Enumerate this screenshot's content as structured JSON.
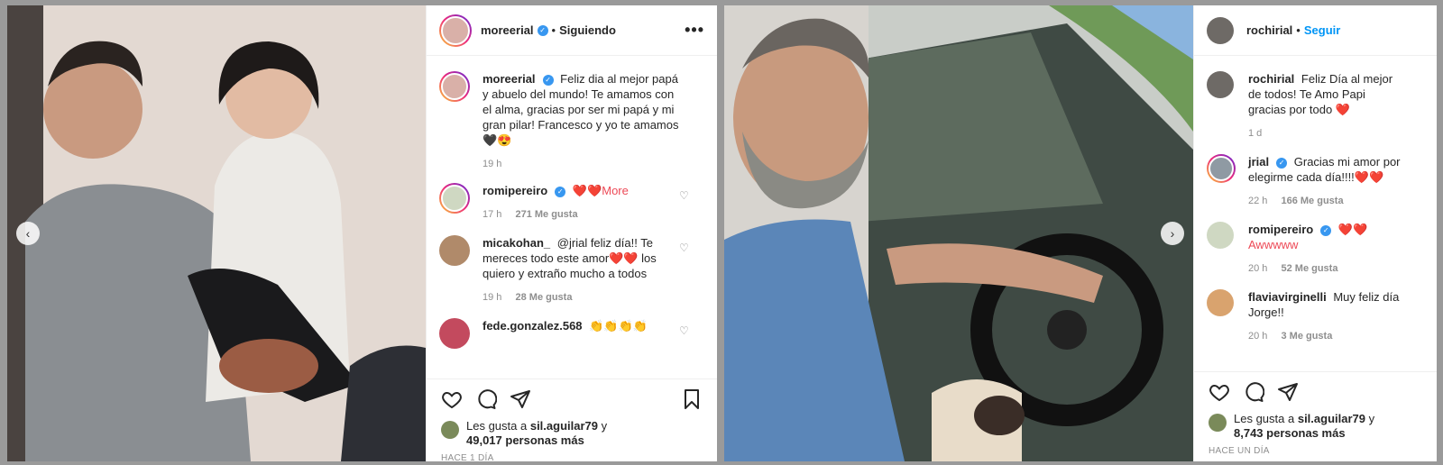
{
  "post1": {
    "header": {
      "username": "moreerial",
      "separator": "•",
      "follow_label": "Siguiendo",
      "more": "•••"
    },
    "caption": {
      "username": "moreerial",
      "text": "Feliz dia al mejor papá y abuelo del mundo! Te amamos con el alma, gracias por ser mi papá y mi gran pilar! Francesco y yo te amamos🖤😍",
      "time": "19 h"
    },
    "comments": [
      {
        "username": "romipereiro",
        "verified": true,
        "text": "❤️❤️More",
        "time": "17 h",
        "likes": "271 Me gusta",
        "avatar_color": "#cfd8c2"
      },
      {
        "username": "micakohan_",
        "verified": false,
        "text": "@jrial feliz día!! Te mereces todo este amor❤️❤️ los quiero y extraño mucho a todos",
        "time": "19 h",
        "likes": "28 Me gusta",
        "avatar_color": "#b08a6a"
      },
      {
        "username": "fede.gonzalez.568",
        "verified": false,
        "text": "👏👏👏👏",
        "time": "",
        "likes": "",
        "avatar_color": "#c34a5e"
      }
    ],
    "likes": {
      "prefix": "Les gusta a",
      "user": "sil.aguilar79",
      "suffix": "y",
      "count": "49,017 personas más"
    },
    "time_ago": "HACE 1 DÍA"
  },
  "post2": {
    "header": {
      "username": "rochirial",
      "separator": "•",
      "follow_label": "Seguir"
    },
    "caption": {
      "username": "rochirial",
      "text": "Feliz Día al mejor de todos! Te Amo Papi gracias por todo ❤️",
      "time": "1 d"
    },
    "comments": [
      {
        "username": "jrial",
        "verified": true,
        "text": "Gracias mi amor por elegirme cada día!!!!❤️❤️",
        "time": "22 h",
        "likes": "166 Me gusta",
        "avatar_color": "#8f9aa3"
      },
      {
        "username": "romipereiro",
        "verified": true,
        "text": "❤️❤️Awwwww",
        "time": "20 h",
        "likes": "52 Me gusta",
        "avatar_color": "#cfd8c2"
      },
      {
        "username": "flaviavirginelli",
        "verified": false,
        "text": "Muy feliz día Jorge!!",
        "time": "20 h",
        "likes": "3 Me gusta",
        "avatar_color": "#d9a36e"
      }
    ],
    "likes": {
      "prefix": "Les gusta a",
      "user": "sil.aguilar79",
      "suffix": "y",
      "count": "8,743 personas más"
    },
    "time_ago": "HACE UN DÍA"
  },
  "colors": {
    "verified": "#3897f0",
    "follow_blue": "#0095f6",
    "heart_red": "#ed4956"
  },
  "icons": [
    "heart-icon",
    "comment-icon",
    "share-icon",
    "bookmark-icon",
    "chevron-left-icon",
    "chevron-right-icon"
  ]
}
